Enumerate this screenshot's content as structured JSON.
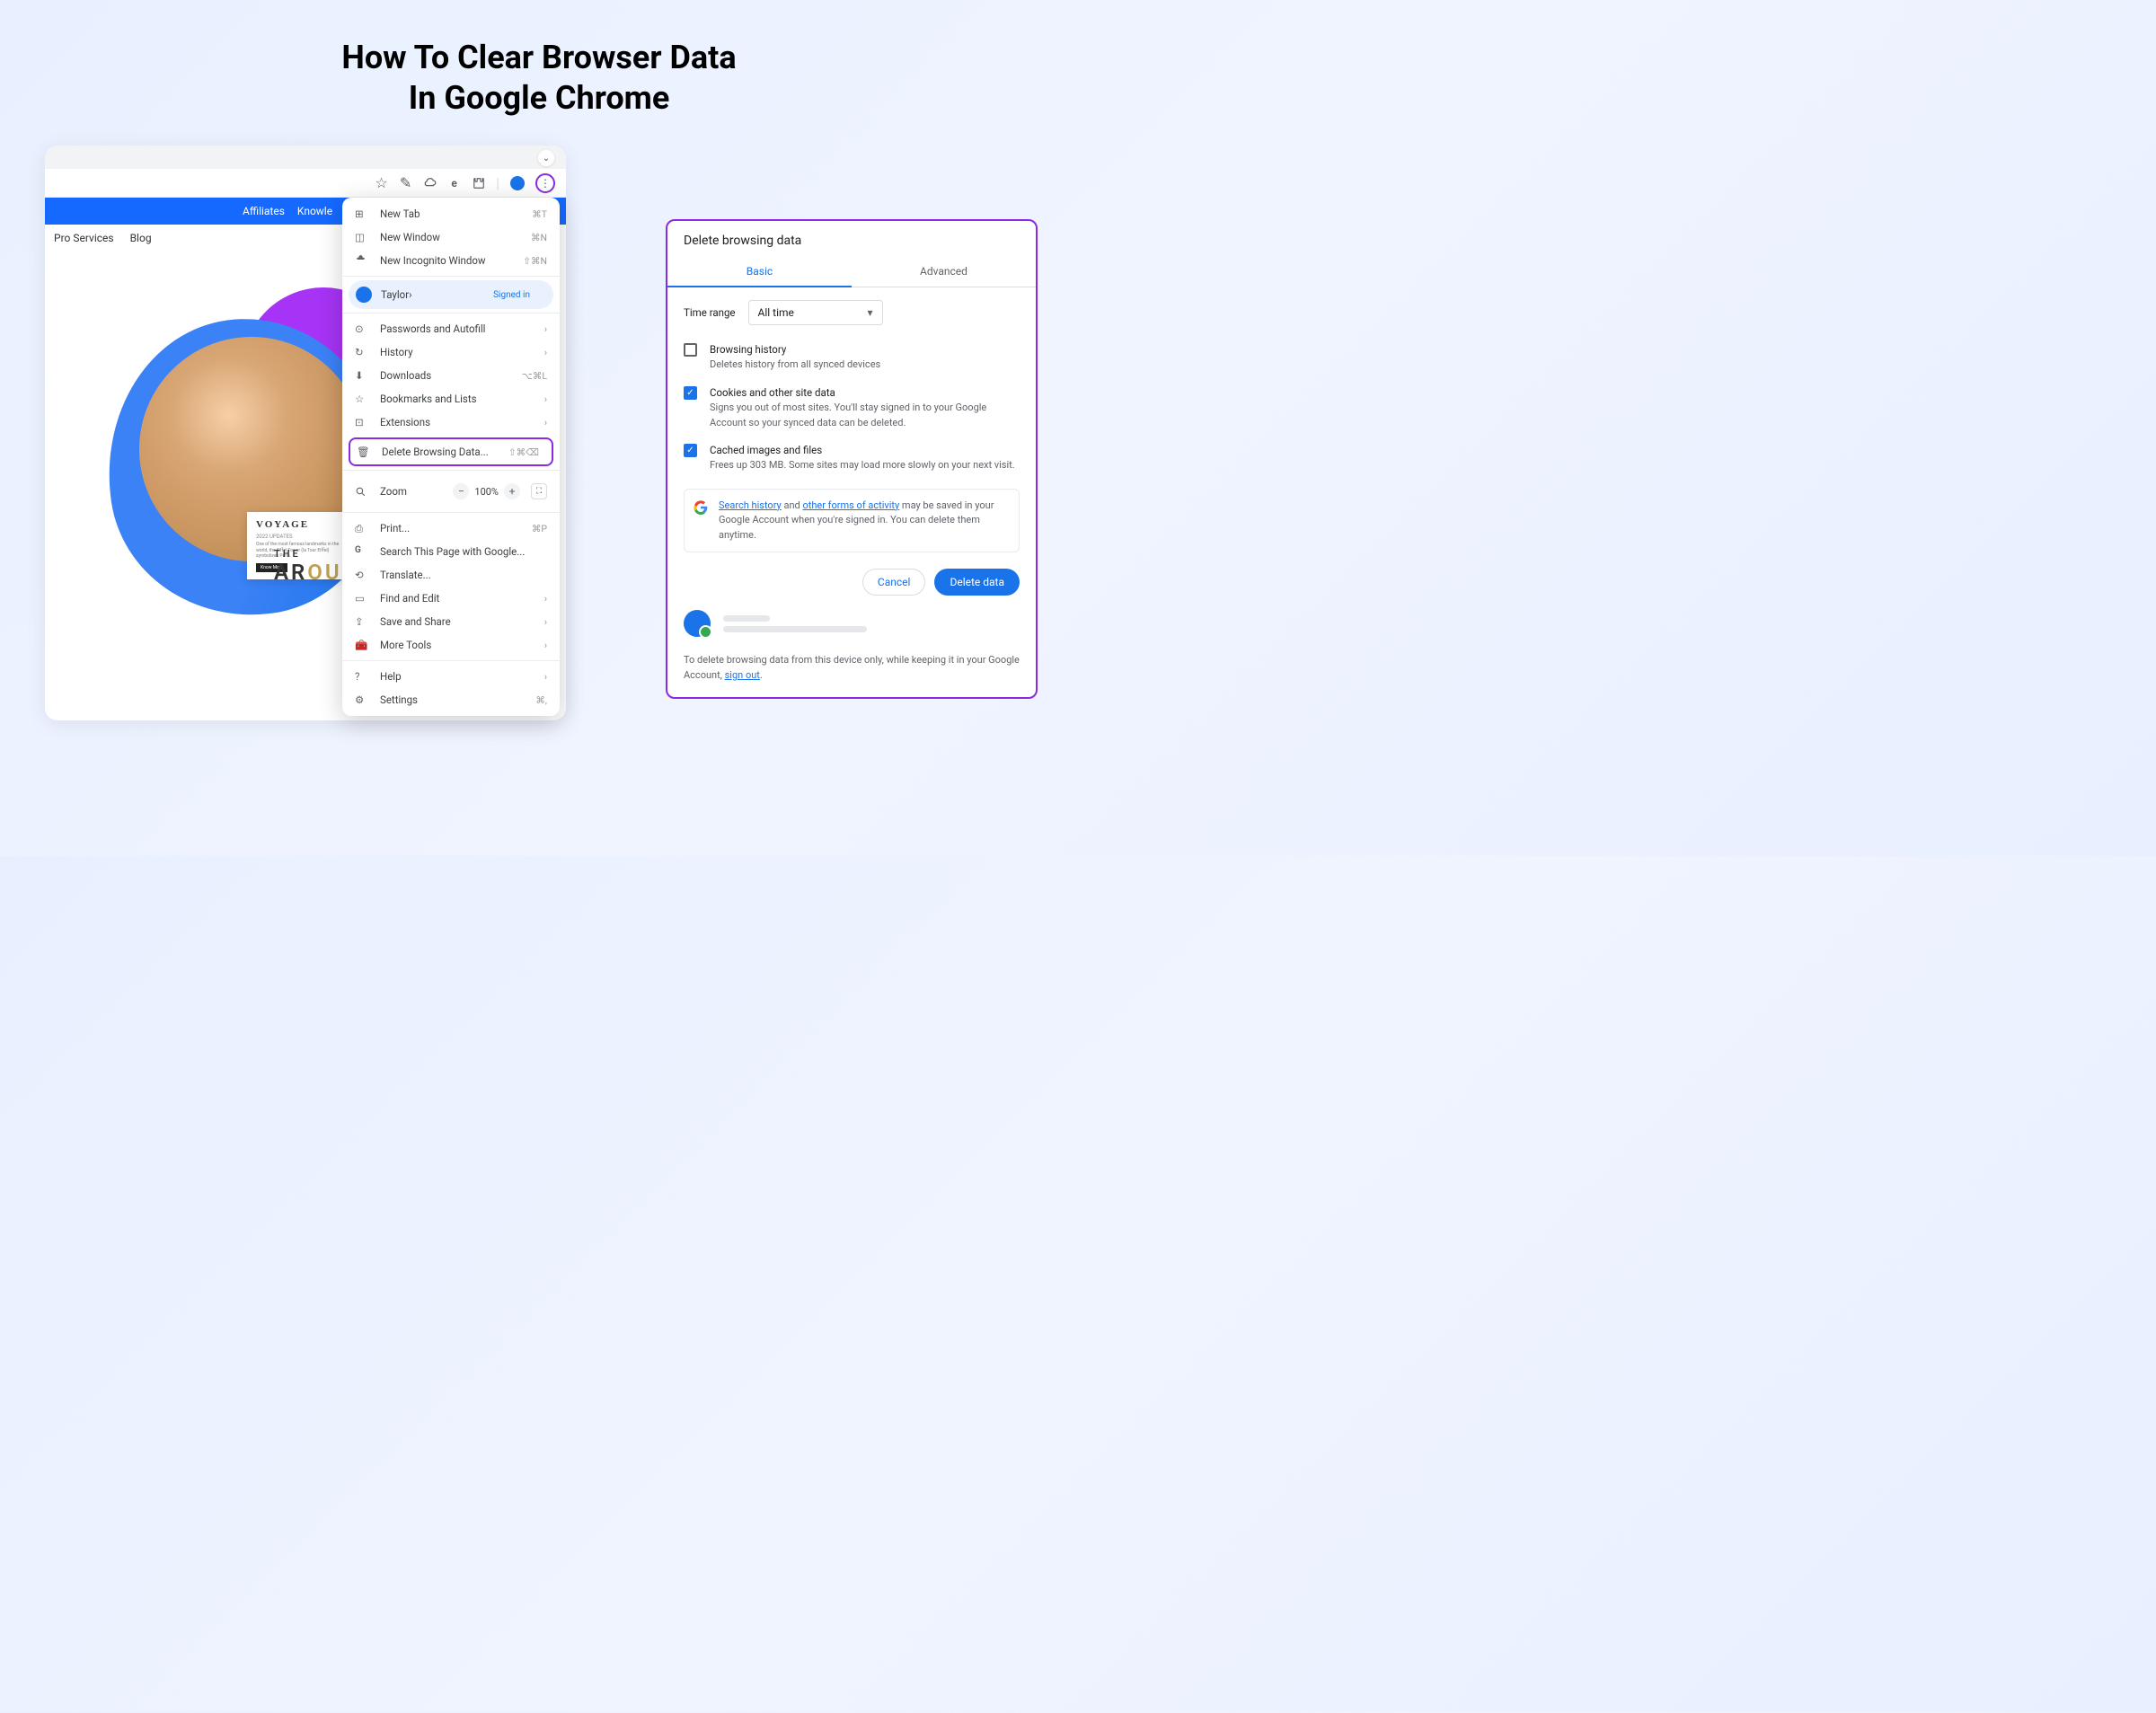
{
  "pageTitle": "How To Clear Browser Data\nIn Google Chrome",
  "browser": {
    "blueNav": [
      "Affiliates",
      "Knowle"
    ],
    "underNav": [
      "Pro Services",
      "Blog"
    ]
  },
  "card": {
    "title": "VOYAGE",
    "sub": "2022 UPDATES",
    "desc": "One of the most famous landmarks in the world, the Eiffel Tower (la Tour Eiffel) symbolizes Paris.",
    "btn": "Know More"
  },
  "arc": {
    "the": "THE",
    "word": "ARO"
  },
  "menu": {
    "newTab": "New Tab",
    "newTabSc": "⌘T",
    "newWin": "New Window",
    "newWinSc": "⌘N",
    "newInc": "New Incognito Window",
    "newIncSc": "⇧⌘N",
    "account": "Taylor",
    "signedIn": "Signed in",
    "passwords": "Passwords and Autofill",
    "history": "History",
    "downloads": "Downloads",
    "downloadsSc": "⌥⌘L",
    "bookmarks": "Bookmarks and Lists",
    "extensions": "Extensions",
    "delete": "Delete Browsing Data...",
    "deleteSc": "⇧⌘⌫",
    "zoom": "Zoom",
    "zoomPct": "100%",
    "print": "Print...",
    "printSc": "⌘P",
    "search": "Search This Page with Google...",
    "translate": "Translate...",
    "find": "Find and Edit",
    "save": "Save and Share",
    "tools": "More Tools",
    "help": "Help",
    "settings": "Settings",
    "settingsSc": "⌘,"
  },
  "dialog": {
    "title": "Delete browsing data",
    "tabBasic": "Basic",
    "tabAdv": "Advanced",
    "timeLabel": "Time range",
    "timeValue": "All time",
    "i1t": "Browsing history",
    "i1d": "Deletes history from all synced devices",
    "i2t": "Cookies and other site data",
    "i2d": "Signs you out of most sites. You'll stay signed in to your Google Account so your synced data can be deleted.",
    "i3t": "Cached images and files",
    "i3d": "Frees up 303 MB. Some sites may load more slowly on your next visit.",
    "infoPre": "",
    "infoL1": "Search history",
    "infoMid": " and ",
    "infoL2": "other forms of activity",
    "infoPost": " may be saved in your Google Account when you're signed in. You can delete them anytime.",
    "cancel": "Cancel",
    "confirm": "Delete data",
    "foot": "To delete browsing data from this device only, while keeping it in your Google Account, ",
    "footLink": "sign out"
  }
}
